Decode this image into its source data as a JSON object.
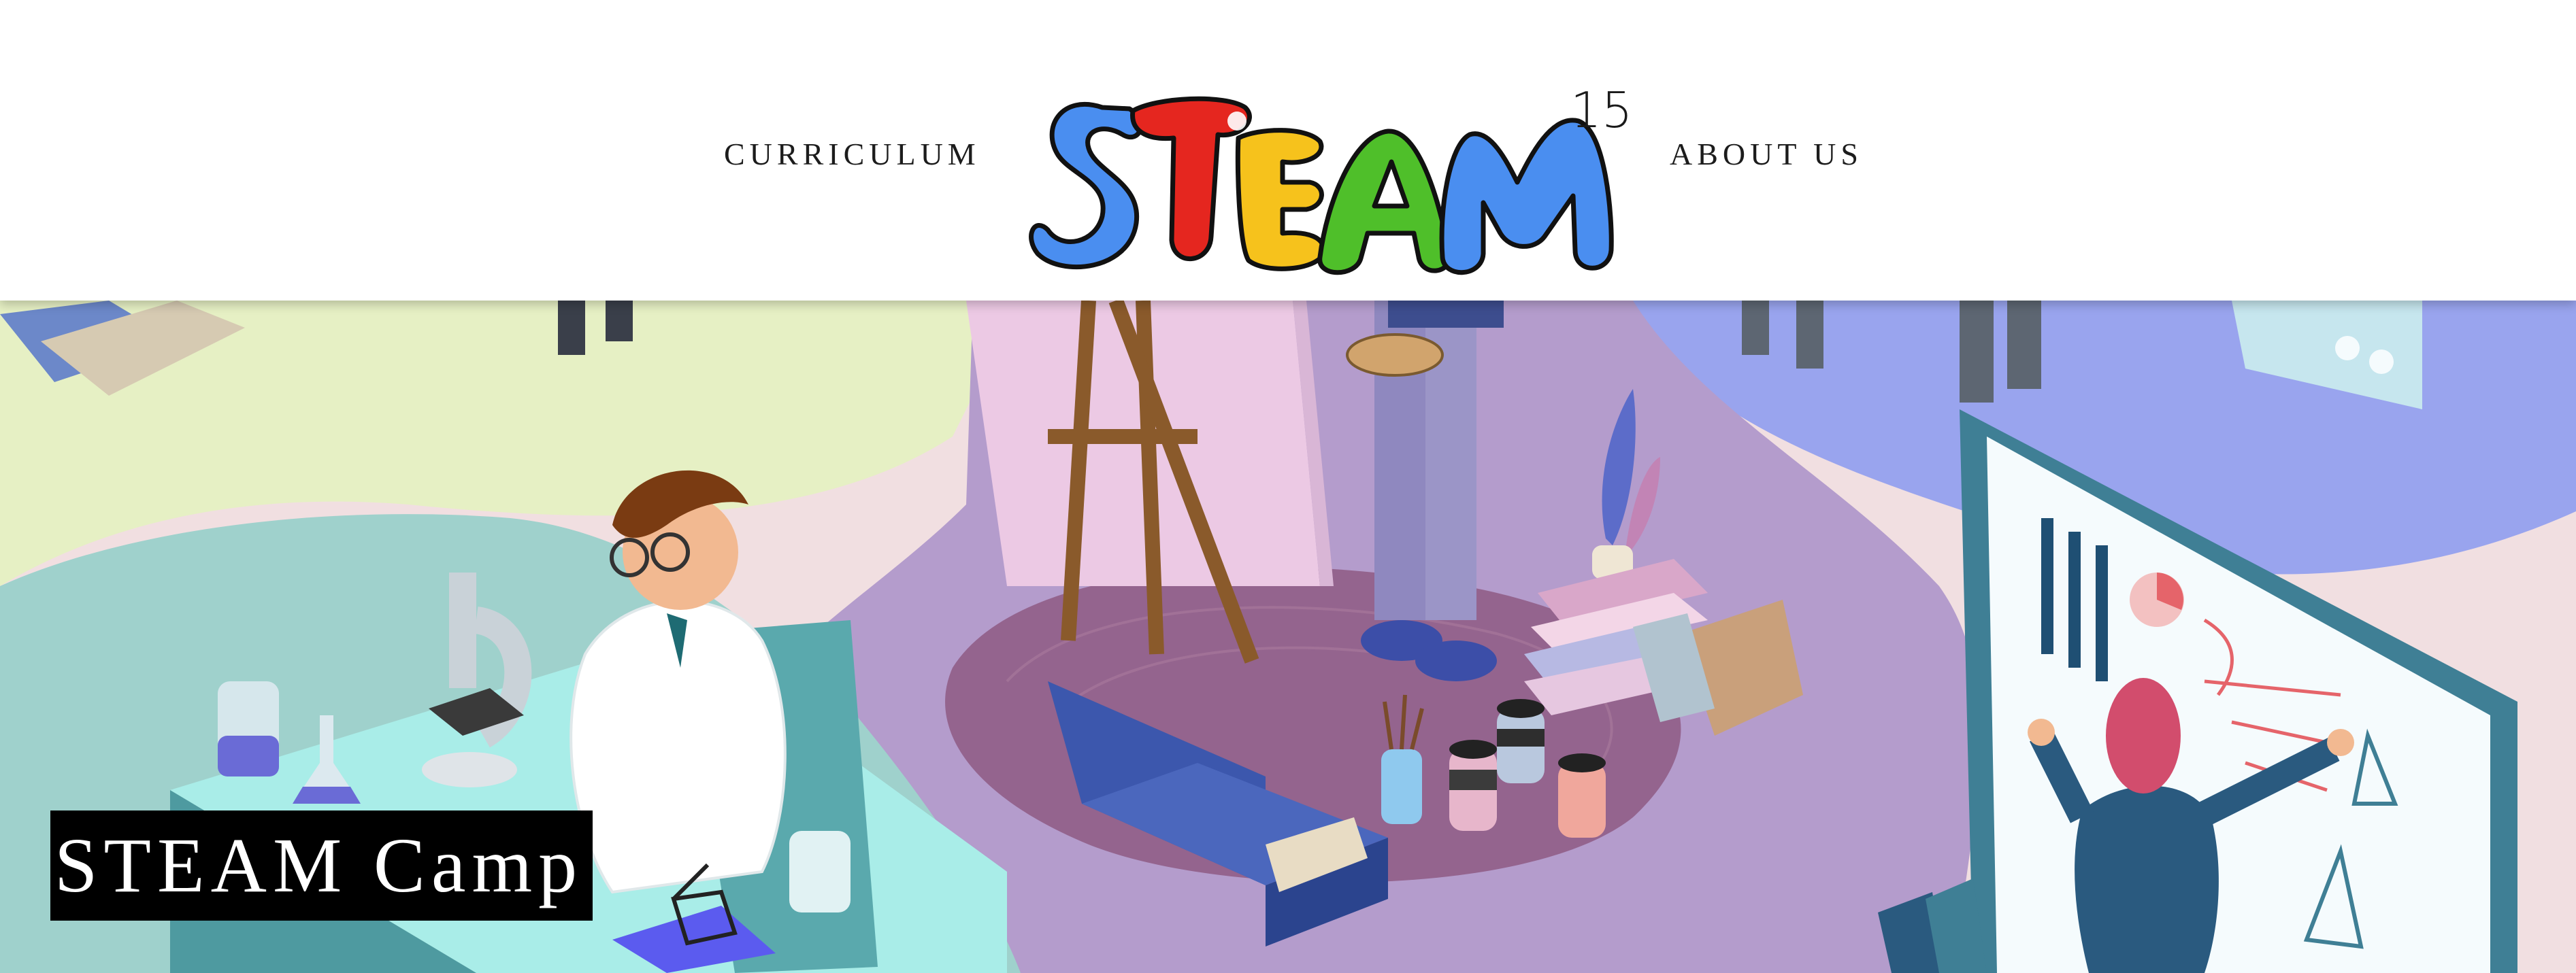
{
  "nav": {
    "left_label": "CURRICULUM",
    "right_label": "ABOUT US"
  },
  "logo": {
    "text": "STEAM",
    "superscript": "15",
    "letter_colors": [
      "#4a8ef0",
      "#e5261f",
      "#f6c21c",
      "#4fbf2a",
      "#4a8ef0"
    ]
  },
  "hero": {
    "title": "STEAM Camp",
    "illustration": "isometric-classroom-illustration"
  },
  "colors": {
    "header_bg": "#ffffff",
    "title_bg": "#000000",
    "title_text": "#ffffff",
    "purple_zone": "#b49ccc",
    "green_zone": "#e6f0c4",
    "blue_zone": "#99a4ee",
    "pink_zone": "#f1dfe1"
  }
}
